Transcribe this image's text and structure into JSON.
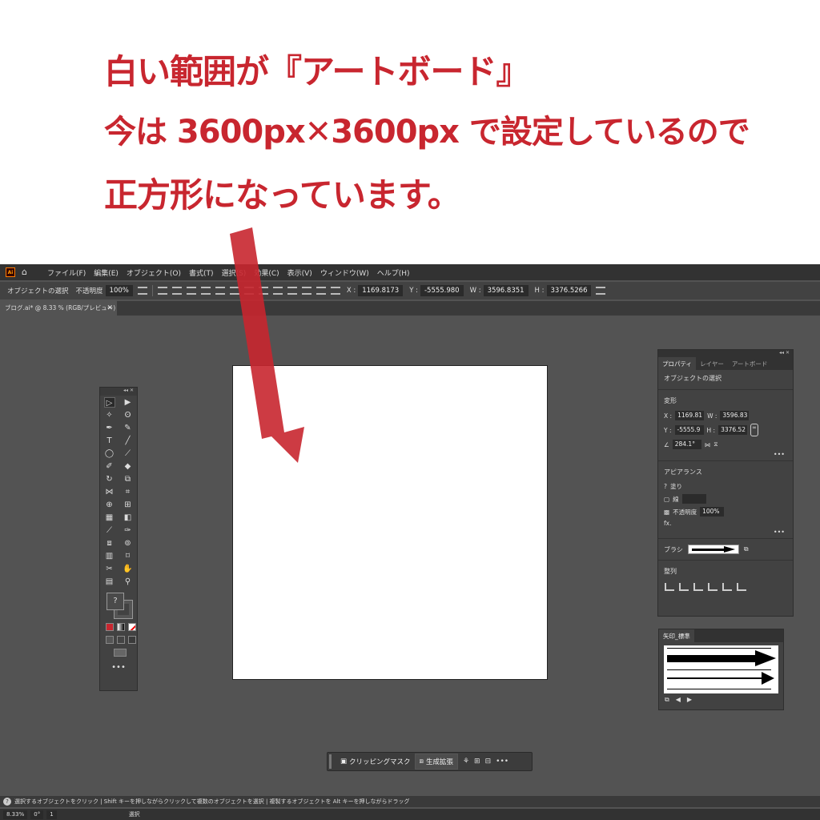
{
  "caption": {
    "line1": "白い範囲が『アートボード』",
    "line2": "今は 3600px✕3600px で設定しているので",
    "line3": "正方形になっています。"
  },
  "colors": {
    "caption_red": "#c8262f",
    "ui_bg": "#535353",
    "panel_bg": "#424242"
  },
  "menu": {
    "logo": "Ai",
    "items": [
      "ファイル(F)",
      "編集(E)",
      "オブジェクト(O)",
      "書式(T)",
      "選択(S)",
      "効果(C)",
      "表示(V)",
      "ウィンドウ(W)",
      "ヘルプ(H)"
    ]
  },
  "control": {
    "label": "オブジェクトの選択",
    "opacity_label": "不透明度",
    "opacity_value": "100%",
    "x_label": "X :",
    "x_value": "1169.8173",
    "y_label": "Y :",
    "y_value": "-5555.980",
    "w_label": "W :",
    "w_value": "3596.8351",
    "h_label": "H :",
    "h_value": "3376.5266"
  },
  "document": {
    "tab_label": "ブログ.ai* @ 8.33 % (RGB/プレビュー)"
  },
  "properties": {
    "tabs": [
      "プロパティ",
      "レイヤー",
      "アートボード"
    ],
    "selection": "オブジェクトの選択",
    "transform_title": "変形",
    "x": "1169.81",
    "y": "-5555.9",
    "w": "3596.83",
    "h": "3376.52",
    "angle": "284.1°",
    "appearance_title": "アピアランス",
    "fill_label": "塗り",
    "stroke_label": "線",
    "opacity_label": "不透明度",
    "opacity_value": "100%",
    "fx_label": "fx.",
    "brush_label": "ブラシ",
    "align_title": "整列"
  },
  "arrows_panel": {
    "tab": "矢印_標準"
  },
  "taskbar": {
    "clip": "クリッピングマスク",
    "expand": "生成拡張"
  },
  "status": {
    "text": "選択するオブジェクトをクリック | Shift キーを押しながらクリックして複数のオブジェクトを選択 | 複製するオブジェクトを Alt キーを押しながらドラッグ",
    "zoom": "8.33%",
    "rotation": "0°",
    "artboard_num": "1",
    "mode": "選択"
  }
}
